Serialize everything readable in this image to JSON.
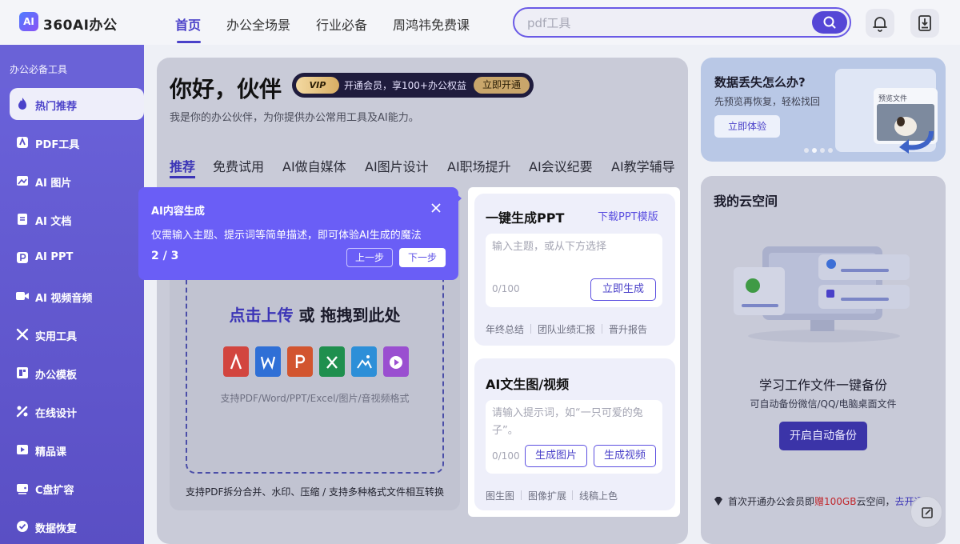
{
  "brand": {
    "logo_mark": "AI",
    "name": "360AI办公"
  },
  "nav": {
    "items": [
      {
        "label": "首页",
        "active": true
      },
      {
        "label": "办公全场景"
      },
      {
        "label": "行业必备"
      },
      {
        "label": "周鸿祎免费课"
      }
    ]
  },
  "search": {
    "placeholder": "pdf工具"
  },
  "sidebar": {
    "heading": "办公必备工具",
    "items": [
      {
        "label": "热门推荐",
        "icon": "flame-icon",
        "active": true
      },
      {
        "label": "PDF工具",
        "icon": "pdf-icon"
      },
      {
        "label": "AI 图片",
        "icon": "image-icon"
      },
      {
        "label": "AI 文档",
        "icon": "document-icon"
      },
      {
        "label": "AI PPT",
        "icon": "ppt-icon"
      },
      {
        "label": "AI 视频音频",
        "icon": "video-icon"
      },
      {
        "label": "实用工具",
        "icon": "tools-icon"
      },
      {
        "label": "办公模板",
        "icon": "template-icon"
      },
      {
        "label": "在线设计",
        "icon": "design-icon"
      },
      {
        "label": "精品课",
        "icon": "course-icon"
      },
      {
        "label": "C盘扩容",
        "icon": "disk-icon"
      },
      {
        "label": "数据恢复",
        "icon": "recover-icon"
      }
    ]
  },
  "hero": {
    "greeting": "你好，伙伴",
    "vip_badge": "VIP",
    "vip_text": "开通会员，享100+办公权益",
    "vip_button": "立即开通",
    "subtitle": "我是你的办公伙伴，为你提供办公常用工具及AI能力。"
  },
  "tabs": [
    {
      "label": "推荐",
      "active": true
    },
    {
      "label": "免费试用"
    },
    {
      "label": "AI做自媒体"
    },
    {
      "label": "AI图片设计"
    },
    {
      "label": "AI职场提升"
    },
    {
      "label": "AI会议纪要"
    },
    {
      "label": "AI教学辅导"
    }
  ],
  "upload": {
    "title_highlight": "点击上传",
    "title_rest": " 或 拖拽到此处",
    "formats": "支持PDF/Word/PPT/Excel/图片/音视频格式",
    "footer": "支持PDF拆分合并、水印、压缩 / 支持多种格式文件相互转换",
    "file_types": [
      {
        "icon": "pdf-file-icon",
        "glyph": "⅄",
        "color": "#d2453f"
      },
      {
        "icon": "word-file-icon",
        "glyph": "W",
        "color": "#2f6fd6"
      },
      {
        "icon": "ppt-file-icon",
        "glyph": "P",
        "color": "#d2552f"
      },
      {
        "icon": "excel-file-icon",
        "glyph": "✕",
        "color": "#1f8f4e"
      },
      {
        "icon": "image-file-icon",
        "glyph": "▲",
        "color": "#2d8fd8"
      },
      {
        "icon": "video-file-icon",
        "glyph": "▶",
        "color": "#9a4fd0"
      }
    ]
  },
  "tooltip": {
    "title": "AI内容生成",
    "body": "仅需输入主题、提示词等简单描述，即可体验AI生成的魔法",
    "step": "2 / 3",
    "prev": "上一步",
    "next": "下一步"
  },
  "ppt_card": {
    "title": "一键生成PPT",
    "link": "下载PPT模版",
    "placeholder": "输入主题，或从下方选择",
    "counter": "0/100",
    "button": "立即生成",
    "chips": [
      "年终总结",
      "团队业绩汇报",
      "晋升报告"
    ]
  },
  "media_card": {
    "title": "AI文生图/视频",
    "placeholder": "请输入提示词，如“一只可爱的兔子”。",
    "counter": "0/100",
    "image_button": "生成图片",
    "video_button": "生成视频",
    "chips": [
      "图生图",
      "图像扩展",
      "线稿上色"
    ]
  },
  "recovery": {
    "title": "数据丢失怎么办?",
    "subtitle": "先预览再恢复，轻松找回",
    "button": "立即体验",
    "preview_label": "预览文件"
  },
  "cloud": {
    "title": "我的云空间",
    "headline": "学习工作文件一键备份",
    "sub": "可自动备份微信/QQ/电脑桌面文件",
    "button": "开启自动备份",
    "promo_pre": "首次开通办公会员即",
    "promo_red": "赠100GB",
    "promo_post": "云空间，",
    "promo_link": "去开通"
  },
  "colors": {
    "accent": "#4a41c9",
    "tooltip": "#6a5ef6",
    "sidebar": "#6058d2",
    "vip_gold": "#c9a66b"
  }
}
